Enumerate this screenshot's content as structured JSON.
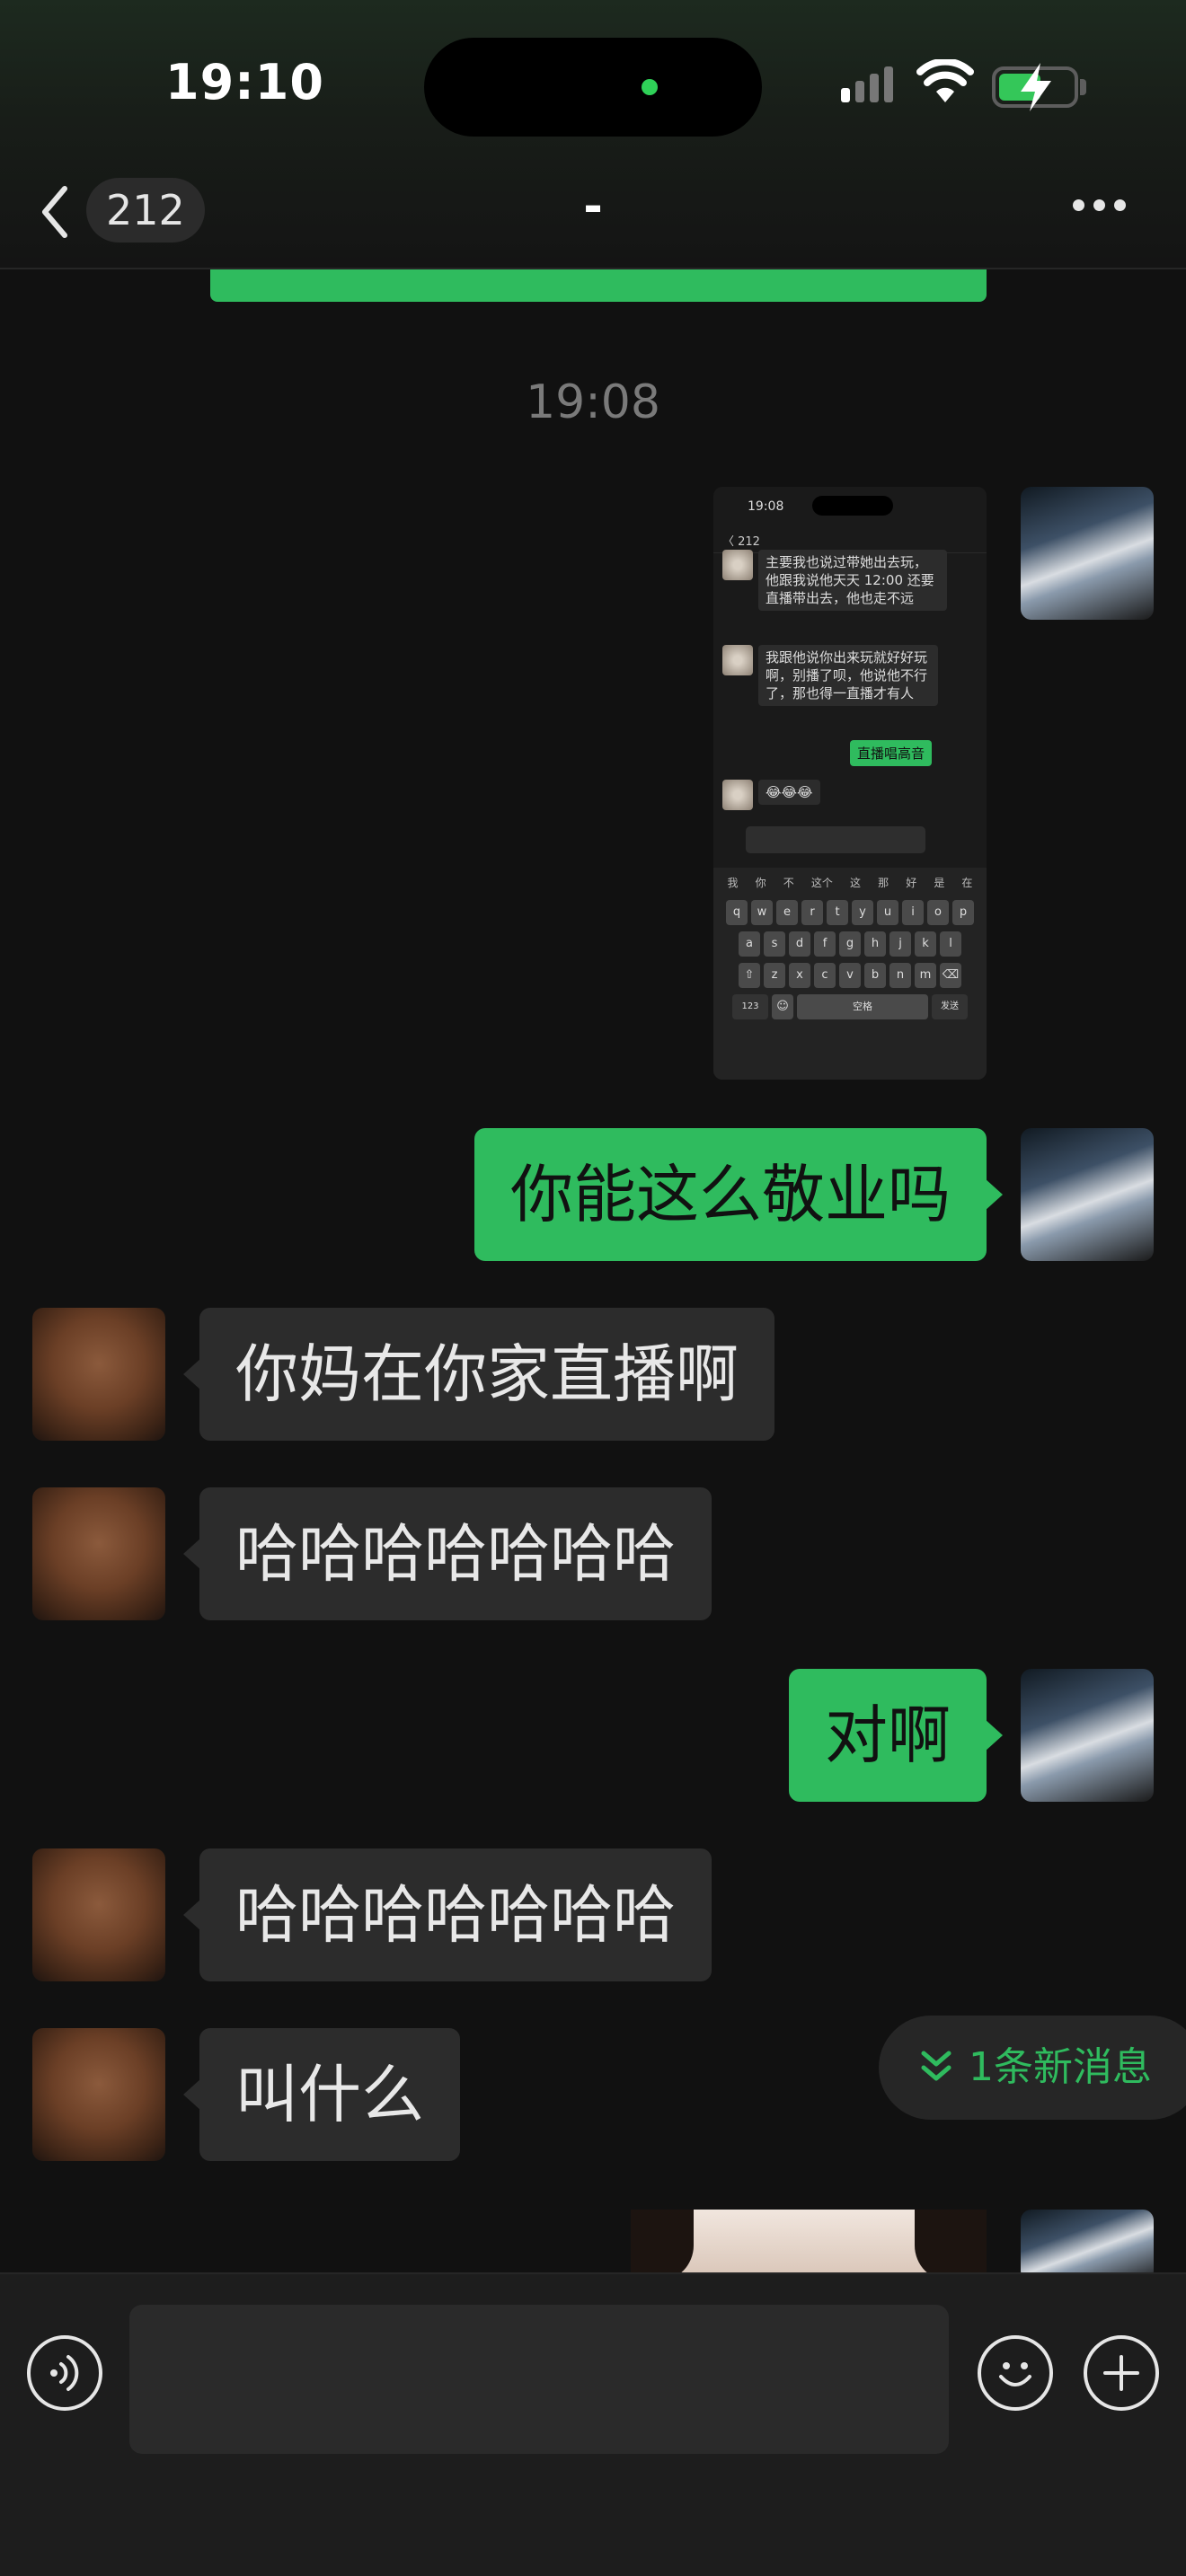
{
  "status_bar": {
    "time": "19:10"
  },
  "header": {
    "back_count": "212",
    "title": "-"
  },
  "timestamp": "19:08",
  "thumbnail": {
    "status_time": "19:08",
    "head_back": "〈 212",
    "messages": [
      "主要我也说过带她出去玩，他跟我说他天天 12:00 还要直播带出去，他也走不远",
      "我跟他说你出来玩就好好玩啊，别播了呗，他说他不行了，那也得一直播才有人"
    ],
    "green_message": "直播唱高音",
    "emoji_message": "😂😂😂",
    "suggestions": [
      "我",
      "你",
      "不",
      "这个",
      "这",
      "那",
      "好",
      "是",
      "在"
    ],
    "keyboard_rows": [
      [
        "q",
        "w",
        "e",
        "r",
        "t",
        "y",
        "u",
        "i",
        "o",
        "p"
      ],
      [
        "a",
        "s",
        "d",
        "f",
        "g",
        "h",
        "j",
        "k",
        "l"
      ],
      [
        "⇧",
        "z",
        "x",
        "c",
        "v",
        "b",
        "n",
        "m",
        "⌫"
      ]
    ],
    "num_key": "123",
    "space_key": "空格",
    "send_key": "发送"
  },
  "messages": [
    {
      "side": "me",
      "text": "你能这么敬业吗"
    },
    {
      "side": "them",
      "text": "你妈在你家直播啊"
    },
    {
      "side": "them",
      "text": "哈哈哈哈哈哈哈"
    },
    {
      "side": "me",
      "text": "对啊"
    },
    {
      "side": "them",
      "text": " 哈哈哈哈哈哈哈"
    },
    {
      "side": "them",
      "text": "叫什么"
    }
  ],
  "new_messages_pill": "1条新消息",
  "colors": {
    "accent": "#2fbb5e",
    "bubble_them": "#2c2c2c",
    "background": "#111111"
  },
  "icons": [
    "chevron-left-icon",
    "more-icon",
    "voice-icon",
    "emoji-icon",
    "plus-icon",
    "chevron-double-down-icon",
    "wifi-icon",
    "battery-icon",
    "signal-icon"
  ]
}
